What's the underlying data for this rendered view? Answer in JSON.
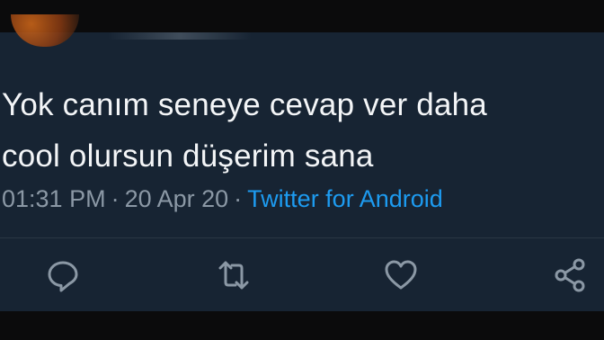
{
  "tweet": {
    "text_line1": "Yok canım seneye cevap ver daha",
    "text_line2": "cool olursun düşerim sana",
    "time": "01:31 PM",
    "date": "20 Apr 20",
    "separator": "·",
    "source": "Twitter for Android"
  },
  "actions": {
    "reply_icon": "reply-icon",
    "retweet_icon": "retweet-icon",
    "like_icon": "heart-icon",
    "share_icon": "share-icon"
  },
  "colors": {
    "background": "#172433",
    "text": "#f3f5f7",
    "muted": "#8b98a5",
    "link": "#1d9bf0"
  }
}
